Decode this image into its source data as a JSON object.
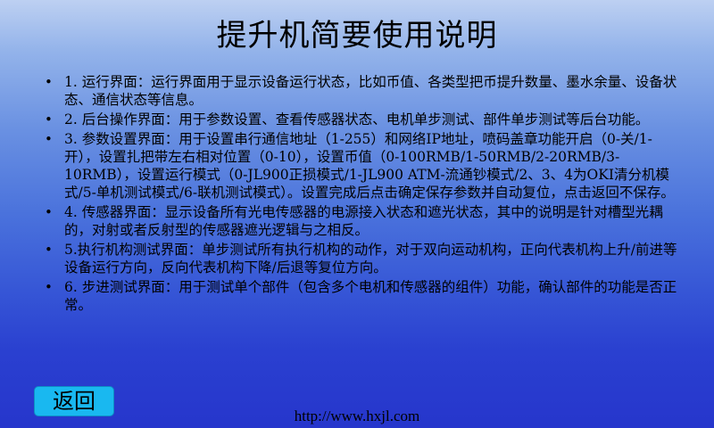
{
  "page": {
    "title": "提升机简要使用说明",
    "footer_url": "http://www.hxjl.com"
  },
  "instructions": {
    "items": [
      {
        "bullet": "•",
        "text": "1. 运行界面：运行界面用于显示设备运行状态，比如币值、各类型把币提升数量、墨水余量、设备状态、通信状态等信息。"
      },
      {
        "bullet": "•",
        "text": "2. 后台操作界面：用于参数设置、查看传感器状态、电机单步测试、部件单步测试等后台功能。"
      },
      {
        "bullet": "•",
        "text": "3. 参数设置界面：用于设置串行通信地址（1-255）和网络IP地址，喷码盖章功能开启（0-关/1-开），设置扎把带左右相对位置（0-10），设置币值（0-100RMB/1-50RMB/2-20RMB/3-10RMB），设置运行模式（0-JL900正损模式/1-JL900 ATM-流通钞模式/2、3、4为OKI清分机模式/5-单机测试模式/6-联机测试模式）。设置完成后点击确定保存参数并自动复位，点击返回不保存。"
      },
      {
        "bullet": "•",
        "text": "4. 传感器界面：显示设备所有光电传感器的电源接入状态和遮光状态，其中的说明是针对槽型光耦的，对射或者反射型的传感器遮光逻辑与之相反。"
      },
      {
        "bullet": "•",
        "text": "5.执行机构测试界面：单步测试所有执行机构的动作，对于双向运动机构，正向代表机构上升/前进等设备运行方向，反向代表机构下降/后退等复位方向。"
      },
      {
        "bullet": "•",
        "text": "6. 步进测试界面：用于测试单个部件（包含多个电机和传感器的组件）功能，确认部件的功能是否正常。"
      }
    ]
  },
  "controls": {
    "back_label": "返回"
  }
}
